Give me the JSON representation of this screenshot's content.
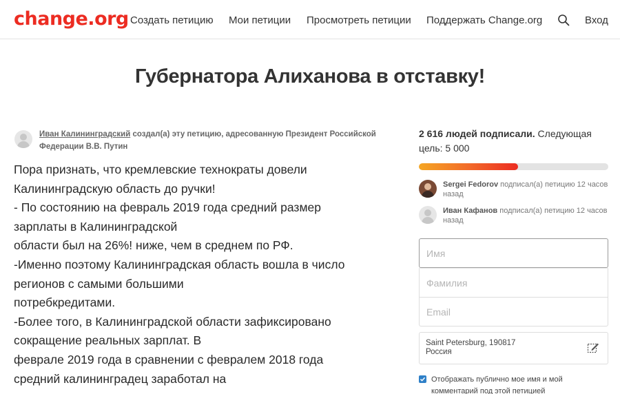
{
  "header": {
    "logo": "change.org",
    "nav": {
      "create": "Создать петицию",
      "my": "Мои петиции",
      "browse": "Просмотреть петиции",
      "support": "Поддержать Change.org",
      "login": "Вход"
    },
    "icons": {
      "search": "search-icon"
    }
  },
  "petition": {
    "title": "Губернатора Алиханова в отставку!",
    "author": {
      "name": "Иван Калининградский",
      "line_rest": " создал(а) эту петицию, адресованную Президент Российской Федерации В.В. Путин"
    },
    "body_lines": [
      "Пора признать, что кремлевские технократы довели",
      "Калининградскую область до ручки!",
      "- По состоянию на февраль 2019 года средний размер",
      "зарплаты в Калининградской",
      "области был на 26%! ниже, чем в среднем по РФ.",
      "-Именно поэтому Калининградская область вошла в число",
      "регионов с самыми большими",
      "потребкредитами.",
      "-Более того, в Калининградской области зафиксировано",
      "сокращение реальных зарплат. В",
      "феврале 2019 года в сравнении с февралем 2018 года",
      "средний калининградец заработал на"
    ]
  },
  "sidebar": {
    "signatures_bold": "2 616 людей подписали.",
    "signatures_rest": " Следующая цель: 5 000",
    "progress_fraction": 0.5232,
    "colors": {
      "progress_start": "#f5a623",
      "progress_end": "#ec2c22",
      "brand": "#ec2c22",
      "checkbox": "#2f80c8"
    },
    "recent": [
      {
        "name": "Sergei Fedorov",
        "action": " подписал(а) петицию 12 часов назад"
      },
      {
        "name": "Иван Кафанов",
        "action": " подписал(а) петицию 12 часов назад"
      }
    ],
    "form": {
      "first_name_placeholder": "Имя",
      "last_name_placeholder": "Фамилия",
      "email_placeholder": "Email",
      "location_line1": "Saint Petersburg, 190817",
      "location_line2": "Россия",
      "public_checkbox_label": "Отображать публично мое имя и мой комментарий под этой петицией",
      "public_checkbox_checked": true
    }
  }
}
